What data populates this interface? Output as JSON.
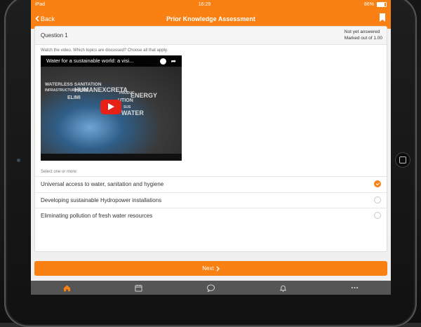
{
  "status": {
    "device": "iPad",
    "time": "16:29",
    "battery": "86%"
  },
  "header": {
    "back_label": "Back",
    "title": "Prior Knowledge Assessment"
  },
  "question": {
    "number_label": "Question 1",
    "state": "Not yet answered",
    "marks": "Marked out of 1.00",
    "prompt": "Watch the video. Which topics are discussed? Choose all that apply.",
    "video": {
      "title": "Water for a sustainable world: a visi...",
      "art_words": [
        "WATERLESS SANITATION",
        "INFRASTRUCTURE USES",
        "HUMANEXCRETA",
        "ENERGY",
        "ELIMI",
        "UTION",
        "WATER",
        "PRODUC",
        "SUS"
      ]
    },
    "select_label": "Select one or more:",
    "options": [
      {
        "label": "Universal access to water, sanitation and hygiene",
        "checked": true
      },
      {
        "label": "Developing sustainable Hydropower installations",
        "checked": false
      },
      {
        "label": "Eliminating pollution of fresh water resources",
        "checked": false
      }
    ]
  },
  "next_label": "Next",
  "tabs": [
    "home-icon",
    "calendar-icon",
    "chat-icon",
    "bell-icon",
    "more-icon"
  ],
  "colors": {
    "accent": "#f98012",
    "tabbar": "#555555"
  }
}
